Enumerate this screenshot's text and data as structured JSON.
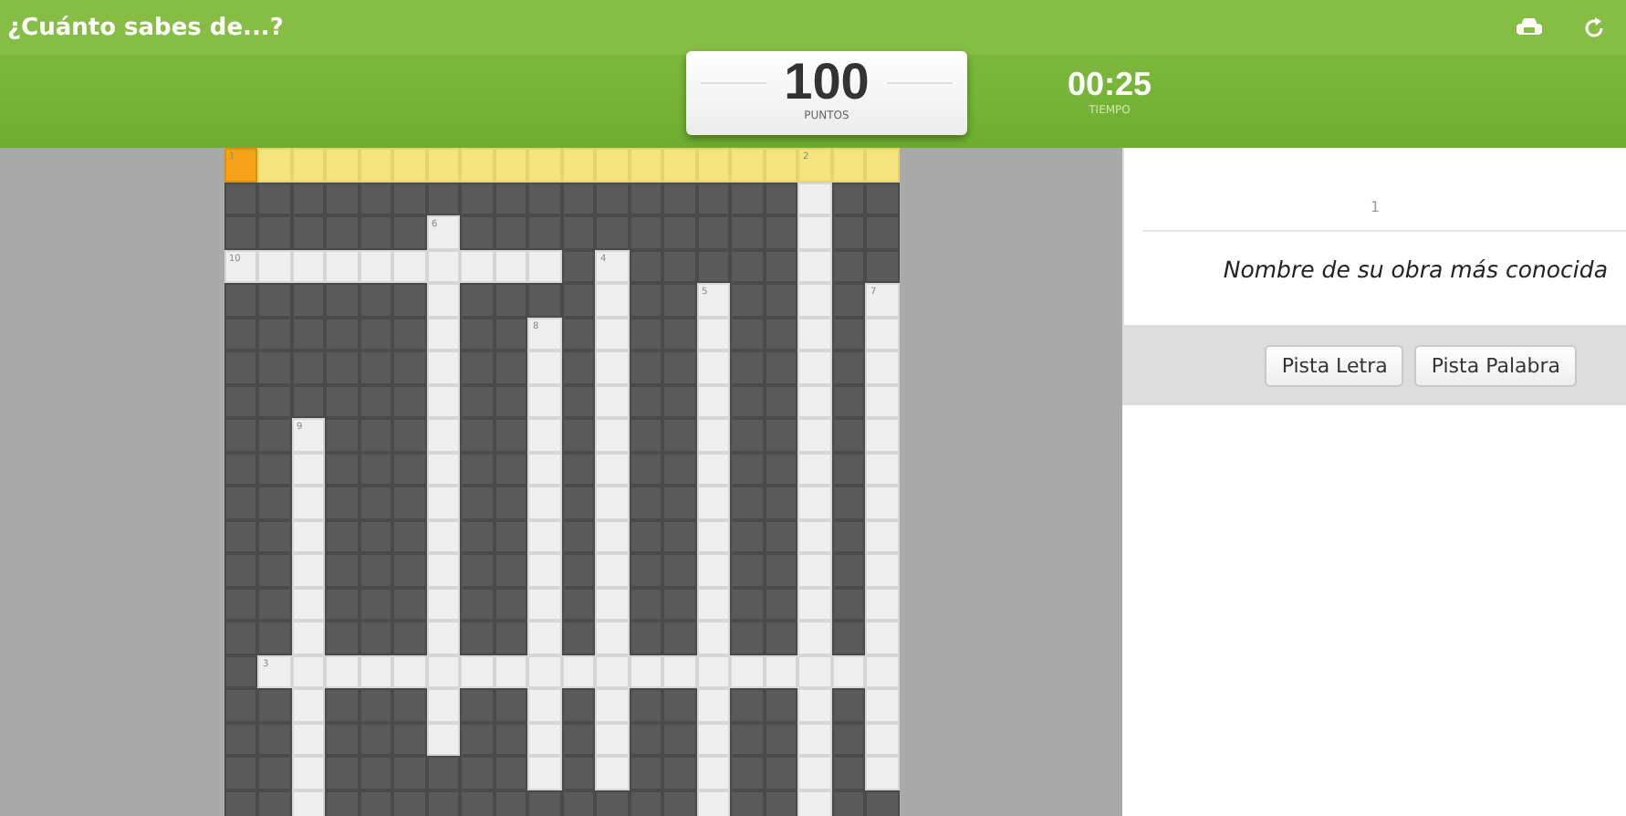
{
  "header": {
    "title": "¿Cuánto sabes de...?"
  },
  "score": {
    "value": "100",
    "label": "PUNTOS"
  },
  "timer": {
    "value": "00:25",
    "label": "TIEMPO"
  },
  "grid": {
    "rows": [
      {
        "cells": [
          {
            "kind": "cursor",
            "number": "1"
          },
          {
            "kind": "lit"
          },
          {
            "kind": "lit"
          },
          {
            "kind": "lit"
          },
          {
            "kind": "lit"
          },
          {
            "kind": "lit"
          },
          {
            "kind": "lit"
          },
          {
            "kind": "lit"
          },
          {
            "kind": "lit"
          },
          {
            "kind": "lit"
          },
          {
            "kind": "lit"
          },
          {
            "kind": "lit"
          },
          {
            "kind": "lit"
          },
          {
            "kind": "lit"
          },
          {
            "kind": "lit"
          },
          {
            "kind": "lit"
          },
          {
            "kind": "lit"
          },
          {
            "kind": "lit",
            "number": "2"
          },
          {
            "kind": "lit"
          },
          {
            "kind": "lit"
          }
        ]
      },
      {
        "cells": [
          {
            "kind": "dark"
          },
          {
            "kind": "dark"
          },
          {
            "kind": "dark"
          },
          {
            "kind": "dark"
          },
          {
            "kind": "dark"
          },
          {
            "kind": "dark"
          },
          {
            "kind": "dark"
          },
          {
            "kind": "dark"
          },
          {
            "kind": "dark"
          },
          {
            "kind": "dark"
          },
          {
            "kind": "dark"
          },
          {
            "kind": "dark"
          },
          {
            "kind": "dark"
          },
          {
            "kind": "dark"
          },
          {
            "kind": "dark"
          },
          {
            "kind": "dark"
          },
          {
            "kind": "dark"
          },
          {
            "kind": "open"
          },
          {
            "kind": "dark"
          },
          {
            "kind": "dark"
          }
        ]
      },
      {
        "cells": [
          {
            "kind": "dark"
          },
          {
            "kind": "dark"
          },
          {
            "kind": "dark"
          },
          {
            "kind": "dark"
          },
          {
            "kind": "dark"
          },
          {
            "kind": "dark"
          },
          {
            "kind": "open",
            "number": "6"
          },
          {
            "kind": "dark"
          },
          {
            "kind": "dark"
          },
          {
            "kind": "dark"
          },
          {
            "kind": "dark"
          },
          {
            "kind": "dark"
          },
          {
            "kind": "dark"
          },
          {
            "kind": "dark"
          },
          {
            "kind": "dark"
          },
          {
            "kind": "dark"
          },
          {
            "kind": "dark"
          },
          {
            "kind": "open"
          },
          {
            "kind": "dark"
          },
          {
            "kind": "dark"
          }
        ]
      },
      {
        "cells": [
          {
            "kind": "open",
            "number": "10"
          },
          {
            "kind": "open"
          },
          {
            "kind": "open"
          },
          {
            "kind": "open"
          },
          {
            "kind": "open"
          },
          {
            "kind": "open"
          },
          {
            "kind": "open"
          },
          {
            "kind": "open"
          },
          {
            "kind": "open"
          },
          {
            "kind": "open"
          },
          {
            "kind": "dark"
          },
          {
            "kind": "open",
            "number": "4"
          },
          {
            "kind": "dark"
          },
          {
            "kind": "dark"
          },
          {
            "kind": "dark"
          },
          {
            "kind": "dark"
          },
          {
            "kind": "dark"
          },
          {
            "kind": "open"
          },
          {
            "kind": "dark"
          },
          {
            "kind": "dark"
          }
        ]
      },
      {
        "cells": [
          {
            "kind": "dark"
          },
          {
            "kind": "dark"
          },
          {
            "kind": "dark"
          },
          {
            "kind": "dark"
          },
          {
            "kind": "dark"
          },
          {
            "kind": "dark"
          },
          {
            "kind": "open"
          },
          {
            "kind": "dark"
          },
          {
            "kind": "dark"
          },
          {
            "kind": "dark"
          },
          {
            "kind": "dark"
          },
          {
            "kind": "open"
          },
          {
            "kind": "dark"
          },
          {
            "kind": "dark"
          },
          {
            "kind": "open",
            "number": "5"
          },
          {
            "kind": "dark"
          },
          {
            "kind": "dark"
          },
          {
            "kind": "open"
          },
          {
            "kind": "dark"
          },
          {
            "kind": "open",
            "number": "7"
          }
        ]
      },
      {
        "cells": [
          {
            "kind": "dark"
          },
          {
            "kind": "dark"
          },
          {
            "kind": "dark"
          },
          {
            "kind": "dark"
          },
          {
            "kind": "dark"
          },
          {
            "kind": "dark"
          },
          {
            "kind": "open"
          },
          {
            "kind": "dark"
          },
          {
            "kind": "dark"
          },
          {
            "kind": "open",
            "number": "8"
          },
          {
            "kind": "dark"
          },
          {
            "kind": "open"
          },
          {
            "kind": "dark"
          },
          {
            "kind": "dark"
          },
          {
            "kind": "open"
          },
          {
            "kind": "dark"
          },
          {
            "kind": "dark"
          },
          {
            "kind": "open"
          },
          {
            "kind": "dark"
          },
          {
            "kind": "open"
          }
        ]
      },
      {
        "cells": [
          {
            "kind": "dark"
          },
          {
            "kind": "dark"
          },
          {
            "kind": "dark"
          },
          {
            "kind": "dark"
          },
          {
            "kind": "dark"
          },
          {
            "kind": "dark"
          },
          {
            "kind": "open"
          },
          {
            "kind": "dark"
          },
          {
            "kind": "dark"
          },
          {
            "kind": "open"
          },
          {
            "kind": "dark"
          },
          {
            "kind": "open"
          },
          {
            "kind": "dark"
          },
          {
            "kind": "dark"
          },
          {
            "kind": "open"
          },
          {
            "kind": "dark"
          },
          {
            "kind": "dark"
          },
          {
            "kind": "open"
          },
          {
            "kind": "dark"
          },
          {
            "kind": "open"
          }
        ]
      },
      {
        "cells": [
          {
            "kind": "dark"
          },
          {
            "kind": "dark"
          },
          {
            "kind": "dark"
          },
          {
            "kind": "dark"
          },
          {
            "kind": "dark"
          },
          {
            "kind": "dark"
          },
          {
            "kind": "open"
          },
          {
            "kind": "dark"
          },
          {
            "kind": "dark"
          },
          {
            "kind": "open"
          },
          {
            "kind": "dark"
          },
          {
            "kind": "open"
          },
          {
            "kind": "dark"
          },
          {
            "kind": "dark"
          },
          {
            "kind": "open"
          },
          {
            "kind": "dark"
          },
          {
            "kind": "dark"
          },
          {
            "kind": "open"
          },
          {
            "kind": "dark"
          },
          {
            "kind": "open"
          }
        ]
      },
      {
        "cells": [
          {
            "kind": "dark"
          },
          {
            "kind": "dark"
          },
          {
            "kind": "open",
            "number": "9"
          },
          {
            "kind": "dark"
          },
          {
            "kind": "dark"
          },
          {
            "kind": "dark"
          },
          {
            "kind": "open"
          },
          {
            "kind": "dark"
          },
          {
            "kind": "dark"
          },
          {
            "kind": "open"
          },
          {
            "kind": "dark"
          },
          {
            "kind": "open"
          },
          {
            "kind": "dark"
          },
          {
            "kind": "dark"
          },
          {
            "kind": "open"
          },
          {
            "kind": "dark"
          },
          {
            "kind": "dark"
          },
          {
            "kind": "open"
          },
          {
            "kind": "dark"
          },
          {
            "kind": "open"
          }
        ]
      },
      {
        "cells": [
          {
            "kind": "dark"
          },
          {
            "kind": "dark"
          },
          {
            "kind": "open"
          },
          {
            "kind": "dark"
          },
          {
            "kind": "dark"
          },
          {
            "kind": "dark"
          },
          {
            "kind": "open"
          },
          {
            "kind": "dark"
          },
          {
            "kind": "dark"
          },
          {
            "kind": "open"
          },
          {
            "kind": "dark"
          },
          {
            "kind": "open"
          },
          {
            "kind": "dark"
          },
          {
            "kind": "dark"
          },
          {
            "kind": "open"
          },
          {
            "kind": "dark"
          },
          {
            "kind": "dark"
          },
          {
            "kind": "open"
          },
          {
            "kind": "dark"
          },
          {
            "kind": "open"
          }
        ]
      },
      {
        "cells": [
          {
            "kind": "dark"
          },
          {
            "kind": "dark"
          },
          {
            "kind": "open"
          },
          {
            "kind": "dark"
          },
          {
            "kind": "dark"
          },
          {
            "kind": "dark"
          },
          {
            "kind": "open"
          },
          {
            "kind": "dark"
          },
          {
            "kind": "dark"
          },
          {
            "kind": "open"
          },
          {
            "kind": "dark"
          },
          {
            "kind": "open"
          },
          {
            "kind": "dark"
          },
          {
            "kind": "dark"
          },
          {
            "kind": "open"
          },
          {
            "kind": "dark"
          },
          {
            "kind": "dark"
          },
          {
            "kind": "open"
          },
          {
            "kind": "dark"
          },
          {
            "kind": "open"
          }
        ]
      },
      {
        "cells": [
          {
            "kind": "dark"
          },
          {
            "kind": "dark"
          },
          {
            "kind": "open"
          },
          {
            "kind": "dark"
          },
          {
            "kind": "dark"
          },
          {
            "kind": "dark"
          },
          {
            "kind": "open"
          },
          {
            "kind": "dark"
          },
          {
            "kind": "dark"
          },
          {
            "kind": "open"
          },
          {
            "kind": "dark"
          },
          {
            "kind": "open"
          },
          {
            "kind": "dark"
          },
          {
            "kind": "dark"
          },
          {
            "kind": "open"
          },
          {
            "kind": "dark"
          },
          {
            "kind": "dark"
          },
          {
            "kind": "open"
          },
          {
            "kind": "dark"
          },
          {
            "kind": "open"
          }
        ]
      },
      {
        "cells": [
          {
            "kind": "dark"
          },
          {
            "kind": "dark"
          },
          {
            "kind": "open"
          },
          {
            "kind": "dark"
          },
          {
            "kind": "dark"
          },
          {
            "kind": "dark"
          },
          {
            "kind": "open"
          },
          {
            "kind": "dark"
          },
          {
            "kind": "dark"
          },
          {
            "kind": "open"
          },
          {
            "kind": "dark"
          },
          {
            "kind": "open"
          },
          {
            "kind": "dark"
          },
          {
            "kind": "dark"
          },
          {
            "kind": "open"
          },
          {
            "kind": "dark"
          },
          {
            "kind": "dark"
          },
          {
            "kind": "open"
          },
          {
            "kind": "dark"
          },
          {
            "kind": "open"
          }
        ]
      },
      {
        "cells": [
          {
            "kind": "dark"
          },
          {
            "kind": "dark"
          },
          {
            "kind": "open"
          },
          {
            "kind": "dark"
          },
          {
            "kind": "dark"
          },
          {
            "kind": "dark"
          },
          {
            "kind": "open"
          },
          {
            "kind": "dark"
          },
          {
            "kind": "dark"
          },
          {
            "kind": "open"
          },
          {
            "kind": "dark"
          },
          {
            "kind": "open"
          },
          {
            "kind": "dark"
          },
          {
            "kind": "dark"
          },
          {
            "kind": "open"
          },
          {
            "kind": "dark"
          },
          {
            "kind": "dark"
          },
          {
            "kind": "open"
          },
          {
            "kind": "dark"
          },
          {
            "kind": "open"
          }
        ]
      },
      {
        "cells": [
          {
            "kind": "dark"
          },
          {
            "kind": "dark"
          },
          {
            "kind": "open"
          },
          {
            "kind": "dark"
          },
          {
            "kind": "dark"
          },
          {
            "kind": "dark"
          },
          {
            "kind": "open"
          },
          {
            "kind": "dark"
          },
          {
            "kind": "dark"
          },
          {
            "kind": "open"
          },
          {
            "kind": "dark"
          },
          {
            "kind": "open"
          },
          {
            "kind": "dark"
          },
          {
            "kind": "dark"
          },
          {
            "kind": "open"
          },
          {
            "kind": "dark"
          },
          {
            "kind": "dark"
          },
          {
            "kind": "open"
          },
          {
            "kind": "dark"
          },
          {
            "kind": "open"
          }
        ]
      },
      {
        "cells": [
          {
            "kind": "dark"
          },
          {
            "kind": "open",
            "number": "3"
          },
          {
            "kind": "open"
          },
          {
            "kind": "open"
          },
          {
            "kind": "open"
          },
          {
            "kind": "open"
          },
          {
            "kind": "open"
          },
          {
            "kind": "open"
          },
          {
            "kind": "open"
          },
          {
            "kind": "open"
          },
          {
            "kind": "open"
          },
          {
            "kind": "open"
          },
          {
            "kind": "open"
          },
          {
            "kind": "open"
          },
          {
            "kind": "open"
          },
          {
            "kind": "open"
          },
          {
            "kind": "open"
          },
          {
            "kind": "open"
          },
          {
            "kind": "open"
          },
          {
            "kind": "open"
          }
        ]
      },
      {
        "cells": [
          {
            "kind": "dark"
          },
          {
            "kind": "dark"
          },
          {
            "kind": "open"
          },
          {
            "kind": "dark"
          },
          {
            "kind": "dark"
          },
          {
            "kind": "dark"
          },
          {
            "kind": "open"
          },
          {
            "kind": "dark"
          },
          {
            "kind": "dark"
          },
          {
            "kind": "open"
          },
          {
            "kind": "dark"
          },
          {
            "kind": "open"
          },
          {
            "kind": "dark"
          },
          {
            "kind": "dark"
          },
          {
            "kind": "open"
          },
          {
            "kind": "dark"
          },
          {
            "kind": "dark"
          },
          {
            "kind": "open"
          },
          {
            "kind": "dark"
          },
          {
            "kind": "open"
          }
        ]
      },
      {
        "cells": [
          {
            "kind": "dark"
          },
          {
            "kind": "dark"
          },
          {
            "kind": "open"
          },
          {
            "kind": "dark"
          },
          {
            "kind": "dark"
          },
          {
            "kind": "dark"
          },
          {
            "kind": "open"
          },
          {
            "kind": "dark"
          },
          {
            "kind": "dark"
          },
          {
            "kind": "open"
          },
          {
            "kind": "dark"
          },
          {
            "kind": "open"
          },
          {
            "kind": "dark"
          },
          {
            "kind": "dark"
          },
          {
            "kind": "open"
          },
          {
            "kind": "dark"
          },
          {
            "kind": "dark"
          },
          {
            "kind": "open"
          },
          {
            "kind": "dark"
          },
          {
            "kind": "open"
          }
        ]
      },
      {
        "cells": [
          {
            "kind": "dark"
          },
          {
            "kind": "dark"
          },
          {
            "kind": "open"
          },
          {
            "kind": "dark"
          },
          {
            "kind": "dark"
          },
          {
            "kind": "dark"
          },
          {
            "kind": "dark"
          },
          {
            "kind": "dark"
          },
          {
            "kind": "dark"
          },
          {
            "kind": "open"
          },
          {
            "kind": "dark"
          },
          {
            "kind": "open"
          },
          {
            "kind": "dark"
          },
          {
            "kind": "dark"
          },
          {
            "kind": "open"
          },
          {
            "kind": "dark"
          },
          {
            "kind": "dark"
          },
          {
            "kind": "open"
          },
          {
            "kind": "dark"
          },
          {
            "kind": "open"
          }
        ]
      },
      {
        "cells": [
          {
            "kind": "dark"
          },
          {
            "kind": "dark"
          },
          {
            "kind": "open"
          },
          {
            "kind": "dark"
          },
          {
            "kind": "dark"
          },
          {
            "kind": "dark"
          },
          {
            "kind": "dark"
          },
          {
            "kind": "dark"
          },
          {
            "kind": "dark"
          },
          {
            "kind": "dark"
          },
          {
            "kind": "dark"
          },
          {
            "kind": "dark"
          },
          {
            "kind": "dark"
          },
          {
            "kind": "dark"
          },
          {
            "kind": "open"
          },
          {
            "kind": "dark"
          },
          {
            "kind": "dark"
          },
          {
            "kind": "open"
          },
          {
            "kind": "dark"
          },
          {
            "kind": "dark"
          }
        ]
      }
    ]
  },
  "clue": {
    "number": "1",
    "text": "Nombre de su obra más conocida"
  },
  "buttons": [
    "Pista Letra",
    "Pista Palabra"
  ]
}
